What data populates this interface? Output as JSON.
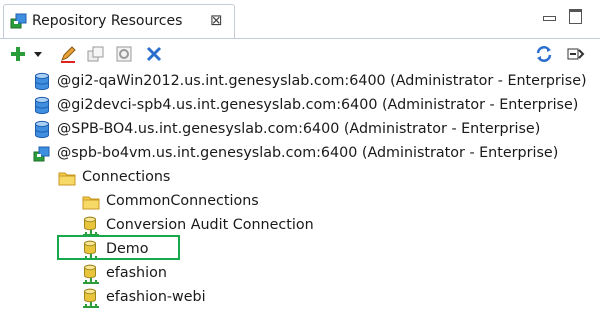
{
  "tab": {
    "title": "Repository Resources",
    "close_glyph": "⊠"
  },
  "window_controls": {
    "minimize": "minimize-icon",
    "maximize": "maximize-icon"
  },
  "toolbar": {
    "buttons": [
      "add-icon",
      "dropdown-arrow-icon",
      "edit-icon",
      "duplicate-icon",
      "properties-icon",
      "delete-icon",
      "refresh-icon",
      "collapse-all-icon"
    ]
  },
  "tree": {
    "servers": [
      {
        "label": "@gi2-qaWin2012.us.int.genesyslab.com:6400 (Administrator - Enterprise)"
      },
      {
        "label": "@gi2devci-spb4.us.int.genesyslab.com:6400 (Administrator - Enterprise)"
      },
      {
        "label": "@SPB-BO4.us.int.genesyslab.com:6400 (Administrator - Enterprise)"
      },
      {
        "label": "@spb-bo4vm.us.int.genesyslab.com:6400 (Administrator - Enterprise)"
      }
    ],
    "folder": {
      "label": "Connections"
    },
    "children": [
      {
        "label": "CommonConnections",
        "icon": "folder-icon"
      },
      {
        "label": "Conversion Audit Connection",
        "icon": "connection-icon"
      },
      {
        "label": "Demo",
        "icon": "connection-icon"
      },
      {
        "label": "efashion",
        "icon": "connection-icon"
      },
      {
        "label": "efashion-webi",
        "icon": "connection-icon"
      }
    ]
  },
  "colors": {
    "highlight_border": "#18a84c",
    "db_blue": "#2f7fd6",
    "db_green": "#2a9d3a",
    "folder_yellow": "#f3c94a"
  }
}
